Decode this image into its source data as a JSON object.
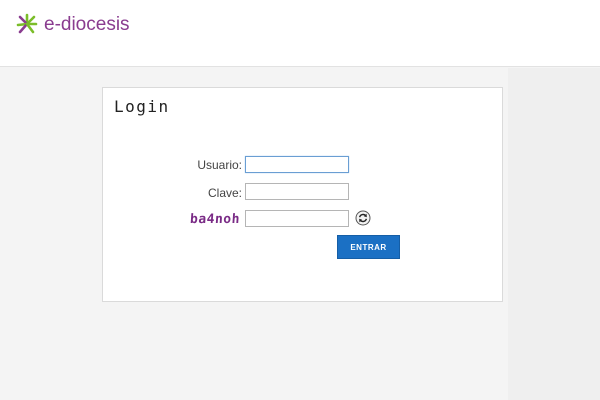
{
  "header": {
    "logo_text": "e-diocesis",
    "logo_icon": "green-purple-sunburst-icon",
    "brand_colors": {
      "green": "#7bbd29",
      "purple": "#8a3c8f"
    }
  },
  "login": {
    "title": "Login",
    "username_label": "Usuario:",
    "username_value": "",
    "password_label": "Clave:",
    "password_value": "",
    "captcha_text": "ba4noh",
    "captcha_value": "",
    "refresh_icon": "refresh-icon",
    "submit_label": "ENTRAR",
    "accent": "#1b70c4"
  }
}
